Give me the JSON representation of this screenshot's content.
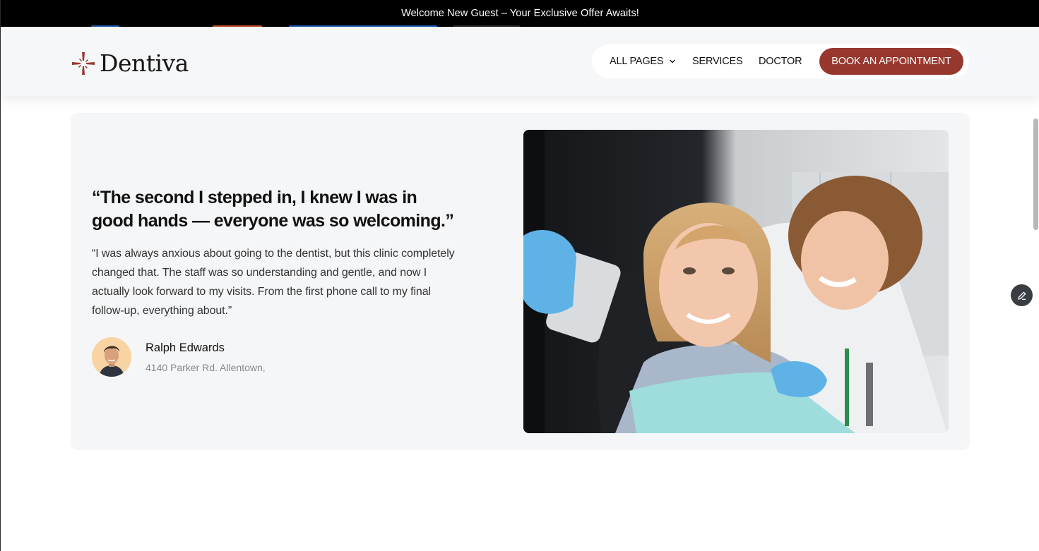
{
  "announcement": {
    "text": "Welcome New Guest – Your Exclusive Offer Awaits!"
  },
  "header": {
    "logo_text": "Dentiva",
    "nav": {
      "all_pages": "ALL PAGES",
      "services": "SERVICES",
      "doctor": "DOCTOR",
      "cta": "BOOK AN APPOINTMENT"
    }
  },
  "testimonial": {
    "headline": "“The second I stepped in, I knew I was in good hands — everyone was so welcoming.”",
    "body": "“I was always anxious about going to the dentist, but this clinic completely changed that. The staff was so understanding and gentle, and now I actually look forward to my visits. From the first phone call to my final follow-up, everything about.”",
    "author_name": "Ralph Edwards",
    "author_address": "4140 Parker Rd. Allentown,"
  },
  "colors": {
    "brand": "#97372d",
    "announcement_bg": "#000000",
    "header_bg": "#f6f7f9",
    "card_bg": "#f5f6f8"
  },
  "icons": {
    "logo": "cross-logo-icon",
    "dropdown": "chevron-down-icon",
    "edit": "pencil-icon"
  }
}
